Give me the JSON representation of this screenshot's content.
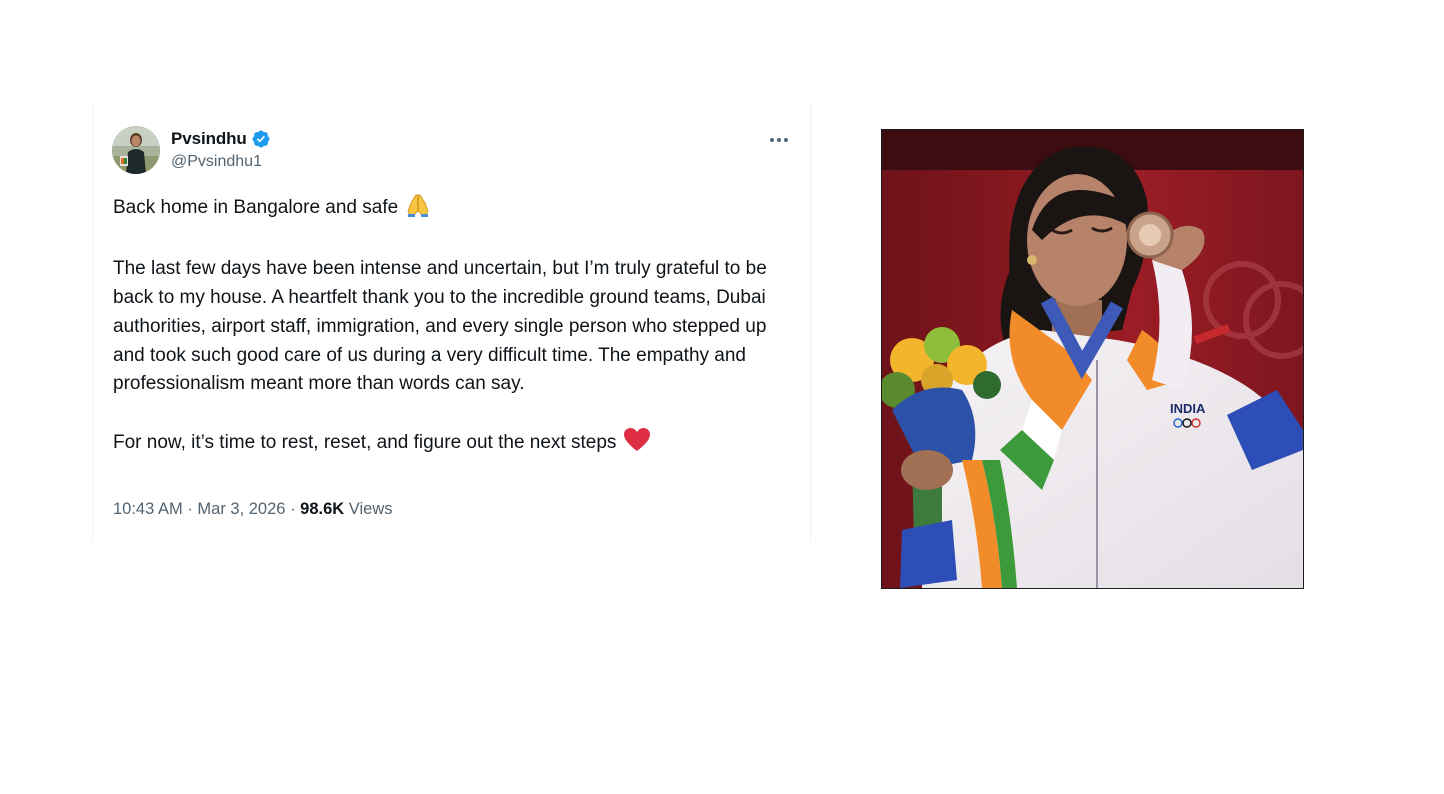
{
  "tweet": {
    "author": {
      "display_name": "Pvsindhu",
      "handle": "@Pvsindhu1",
      "verified": true
    },
    "text": {
      "paragraph_1": "Back home in Bangalore and safe",
      "paragraph_2": "The last few days have been intense and uncertain, but I’m truly grateful to be back to my house. A heartfelt thank you to the incredible ground teams, Dubai authorities, airport staff, immigration, and every single person who stepped up and took such good care of us during a very difficult time. The empathy and professionalism meant more than words can say.",
      "paragraph_3": "For now, it’s time to rest, reset, and figure out the next steps"
    },
    "emojis": {
      "paragraph_1": "folded-hands-icon",
      "paragraph_3": "red-heart-icon"
    },
    "meta": {
      "time": "10:43 AM",
      "separator": "·",
      "date": "Mar 3, 2026",
      "views_count": "98.6K",
      "views_label": "Views"
    },
    "icons": {
      "more": "more-horizontal-icon",
      "verified": "verified-badge-icon"
    }
  },
  "photo": {
    "jacket_text": "INDIA"
  },
  "colors": {
    "text_primary": "#0f1419",
    "text_secondary": "#536471",
    "verified_blue": "#1d9bf0",
    "heart_red": "#e0245e",
    "border": "#eff3f4"
  }
}
